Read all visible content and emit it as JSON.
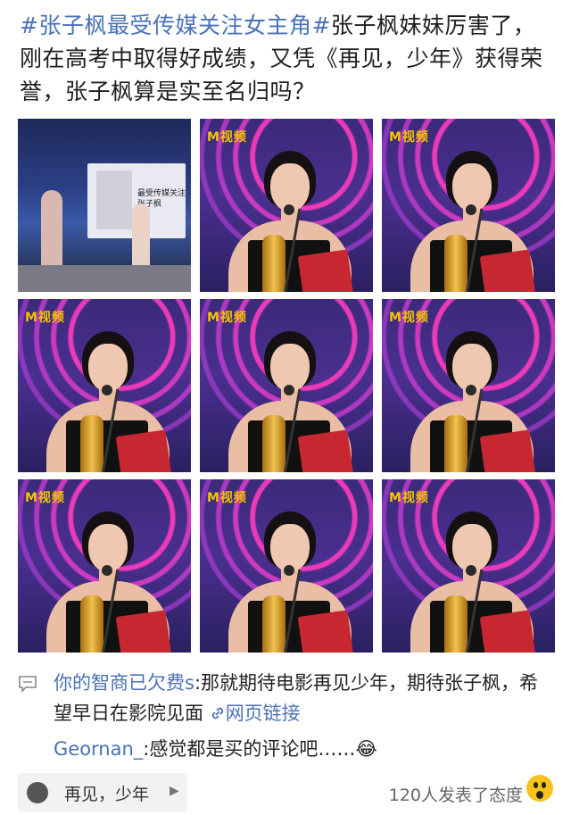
{
  "post": {
    "hashtag": "#张子枫最受传媒关注女主角#",
    "text": "张子枫妹妹厉害了，刚在高考中取得好成绩，又凭《再见，少年》获得荣誉，张子枫算是实至名归吗？"
  },
  "images": {
    "logo_text": "M视频",
    "screen_text_line1": "最受传媒关注",
    "screen_text_line2": "张子枫"
  },
  "comments": [
    {
      "user": "你的智商已欠费s",
      "text": ":那就期待电影再见少年，期待张子枫，希望早日在影院见面",
      "link_icon": "link-icon",
      "link_text": "网页链接"
    },
    {
      "user": "Geornan_",
      "text": ":感觉都是买的评论吧……",
      "emoji": "😂"
    }
  ],
  "footer": {
    "topic": "再见，少年",
    "reaction_count": "120人发表了态度"
  },
  "colors": {
    "accent": "#4a72b8",
    "stage_purple": "#4a2f8f",
    "gold": "#f5c400"
  }
}
